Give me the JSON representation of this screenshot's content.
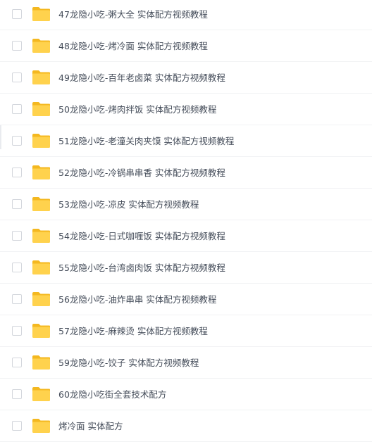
{
  "files": [
    {
      "name": "47龙隐小吃-粥大全 实体配方视频教程",
      "icon": "folder-icon"
    },
    {
      "name": "48龙隐小吃-烤冷面 实体配方视频教程",
      "icon": "folder-icon"
    },
    {
      "name": "49龙隐小吃-百年老卤菜 实体配方视频教程",
      "icon": "folder-icon"
    },
    {
      "name": "50龙隐小吃-烤肉拌饭 实体配方视频教程",
      "icon": "folder-icon"
    },
    {
      "name": "51龙隐小吃-老潼关肉夹馍 实体配方视频教程",
      "icon": "folder-icon"
    },
    {
      "name": "52龙隐小吃-冷锅串串香 实体配方视频教程",
      "icon": "folder-icon"
    },
    {
      "name": "53龙隐小吃-凉皮 实体配方视频教程",
      "icon": "folder-icon"
    },
    {
      "name": "54龙隐小吃-日式咖喱饭 实体配方视频教程",
      "icon": "folder-icon"
    },
    {
      "name": "55龙隐小吃-台湾卤肉饭 实体配方视频教程",
      "icon": "folder-icon"
    },
    {
      "name": "56龙隐小吃-油炸串串 实体配方视频教程",
      "icon": "folder-icon"
    },
    {
      "name": "57龙隐小吃-麻辣烫 实体配方视频教程",
      "icon": "folder-icon"
    },
    {
      "name": "59龙隐小吃-饺子 实体配方视频教程",
      "icon": "folder-icon"
    },
    {
      "name": "60龙隐小吃街全套技术配方",
      "icon": "folder-icon"
    },
    {
      "name": "烤冷面 实体配方",
      "icon": "folder-icon"
    }
  ],
  "colors": {
    "folder_body": "#ffd24d",
    "folder_back": "#f4b820",
    "text": "#454d5a",
    "checkbox_border": "#d3d6dc",
    "divider": "#f1f2f4"
  }
}
